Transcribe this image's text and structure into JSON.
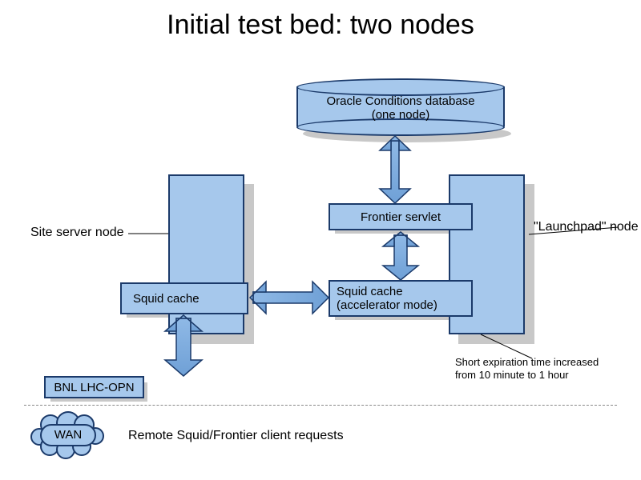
{
  "title": "Initial test bed: two nodes",
  "db": {
    "line1": "Oracle Conditions database",
    "line2": "(one node)"
  },
  "frontier_servlet": "Frontier servlet",
  "site_server_node": "Site server node",
  "launchpad_node": "\"Launchpad\" node",
  "squid_left": "Squid cache",
  "squid_right": {
    "line1": "Squid cache",
    "line2": "(accelerator mode)"
  },
  "expiration_note": {
    "line1": "Short expiration time increased",
    "line2": "from 10 minute to 1 hour"
  },
  "bnl": "BNL LHC-OPN",
  "wan": "WAN",
  "remote_requests": "Remote Squid/Frontier client requests",
  "colors": {
    "fill": "#a6c8ec",
    "stroke": "#1b3a6a",
    "shadow": "#c8c8c8"
  }
}
